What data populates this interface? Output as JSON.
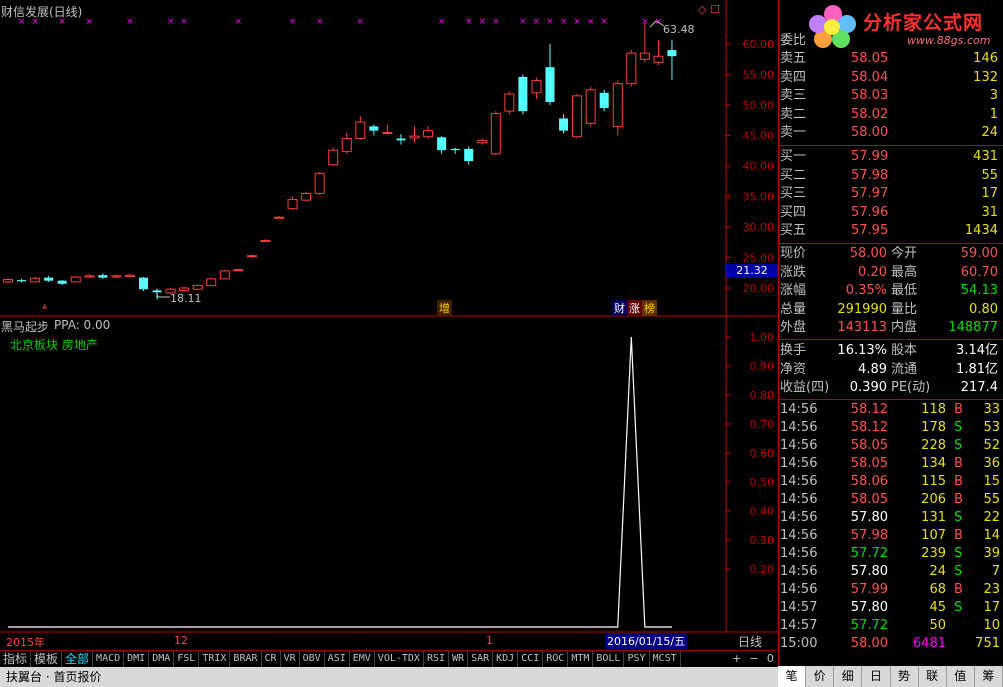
{
  "chart_title": "财信发展(日线)",
  "top_markers": "◇ ☐",
  "price_axis": [
    "60.00",
    "55.00",
    "50.00",
    "45.00",
    "40.00",
    "35.00",
    "30.00",
    "25.00",
    "20.00"
  ],
  "current_price_tag": "21.32",
  "high_label": "63.48",
  "low_label": "18.11",
  "event_labels": {
    "zeng": "增",
    "cai": "财",
    "zhang": "涨",
    "bang": "榜"
  },
  "indicator_name": "黑马起步",
  "indicator_value": "PPA: 0.00",
  "sector_text": "北京板块 房地产",
  "indicator_axis": [
    "1.00",
    "0.90",
    "0.80",
    "0.70",
    "0.60",
    "0.50",
    "0.40",
    "0.30",
    "0.20"
  ],
  "time_axis": {
    "y2015": "2015年",
    "m12": "12",
    "m1": "1",
    "cursor_date": "2016/01/15/五",
    "period": "日线"
  },
  "bottom_tabs": [
    "指标",
    "模板",
    "全部",
    "MACD",
    "DMI",
    "DMA",
    "FSL",
    "TRIX",
    "BRAR",
    "CR",
    "VR",
    "OBV",
    "ASI",
    "EMV",
    "VOL-TDX",
    "RSI",
    "WR",
    "SAR",
    "KDJ",
    "CCI",
    "ROC",
    "MTM",
    "BOLL",
    "PSY",
    "MCST"
  ],
  "right_controls": [
    "+",
    "−",
    "0"
  ],
  "statusbar": {
    "left": "扶翼台 · 首页报价"
  },
  "logo": {
    "title": "分析家公式网",
    "url": "www.88gs.com"
  },
  "orderbook": {
    "header_label": "委比",
    "asks": [
      {
        "label": "卖五",
        "price": "58.05",
        "vol": "146"
      },
      {
        "label": "卖四",
        "price": "58.04",
        "vol": "132"
      },
      {
        "label": "卖三",
        "price": "58.03",
        "vol": "3"
      },
      {
        "label": "卖二",
        "price": "58.02",
        "vol": "1"
      },
      {
        "label": "卖一",
        "price": "58.00",
        "vol": "24"
      }
    ],
    "bids": [
      {
        "label": "买一",
        "price": "57.99",
        "vol": "431"
      },
      {
        "label": "买二",
        "price": "57.98",
        "vol": "55"
      },
      {
        "label": "买三",
        "price": "57.97",
        "vol": "17"
      },
      {
        "label": "买四",
        "price": "57.96",
        "vol": "31"
      },
      {
        "label": "买五",
        "price": "57.95",
        "vol": "1434"
      }
    ]
  },
  "quote": [
    {
      "l1": "现价",
      "v1": "58.00",
      "c1": "red",
      "l2": "今开",
      "v2": "59.00",
      "c2": "red"
    },
    {
      "l1": "涨跌",
      "v1": "0.20",
      "c1": "red",
      "l2": "最高",
      "v2": "60.70",
      "c2": "red"
    },
    {
      "l1": "涨幅",
      "v1": "0.35%",
      "c1": "red",
      "l2": "最低",
      "v2": "54.13",
      "c2": "green"
    },
    {
      "l1": "总量",
      "v1": "291990",
      "c1": "yellow",
      "l2": "量比",
      "v2": "0.80",
      "c2": "yellow"
    },
    {
      "l1": "外盘",
      "v1": "143113",
      "c1": "red",
      "l2": "内盘",
      "v2": "148877",
      "c2": "green"
    }
  ],
  "fundamentals": [
    {
      "l1": "换手",
      "v1": "16.13%",
      "l2": "股本",
      "v2": "3.14亿"
    },
    {
      "l1": "净资",
      "v1": "4.89",
      "l2": "流通",
      "v2": "1.81亿"
    },
    {
      "l1": "收益(四)",
      "v1": "0.390",
      "l2": "PE(动)",
      "v2": "217.4"
    }
  ],
  "ticks": [
    {
      "t": "14:56",
      "p": "58.12",
      "pc": "red",
      "v": "118",
      "s": "B",
      "n": "33"
    },
    {
      "t": "14:56",
      "p": "58.12",
      "pc": "red",
      "v": "178",
      "s": "S",
      "n": "53"
    },
    {
      "t": "14:56",
      "p": "58.05",
      "pc": "red",
      "v": "228",
      "s": "S",
      "n": "52"
    },
    {
      "t": "14:56",
      "p": "58.05",
      "pc": "red",
      "v": "134",
      "s": "B",
      "n": "36"
    },
    {
      "t": "14:56",
      "p": "58.06",
      "pc": "red",
      "v": "115",
      "s": "B",
      "n": "15"
    },
    {
      "t": "14:56",
      "p": "58.05",
      "pc": "red",
      "v": "206",
      "s": "B",
      "n": "55"
    },
    {
      "t": "14:56",
      "p": "57.80",
      "pc": "white",
      "v": "131",
      "s": "S",
      "n": "22"
    },
    {
      "t": "14:56",
      "p": "57.98",
      "pc": "red",
      "v": "107",
      "s": "B",
      "n": "14"
    },
    {
      "t": "14:56",
      "p": "57.72",
      "pc": "green",
      "v": "239",
      "s": "S",
      "n": "39"
    },
    {
      "t": "14:56",
      "p": "57.80",
      "pc": "white",
      "v": "24",
      "s": "S",
      "n": "7"
    },
    {
      "t": "14:56",
      "p": "57.99",
      "pc": "red",
      "v": "68",
      "s": "B",
      "n": "23"
    },
    {
      "t": "14:57",
      "p": "57.80",
      "pc": "white",
      "v": "45",
      "s": "S",
      "n": "17"
    },
    {
      "t": "14:57",
      "p": "57.72",
      "pc": "green",
      "v": "50",
      "s": "",
      "n": "10"
    },
    {
      "t": "15:00",
      "p": "58.00",
      "pc": "red",
      "v": "6481",
      "s": "",
      "n": "751"
    }
  ],
  "right_tabs": [
    "笔",
    "价",
    "细",
    "日",
    "势",
    "联",
    "值",
    "筹"
  ],
  "candles": [
    {
      "o": 21.0,
      "c": 21.4,
      "h": 21.6,
      "l": 20.8
    },
    {
      "o": 21.3,
      "c": 21.1,
      "h": 21.5,
      "l": 20.9
    },
    {
      "o": 21.0,
      "c": 21.6,
      "h": 21.8,
      "l": 20.9
    },
    {
      "o": 21.7,
      "c": 21.2,
      "h": 22.0,
      "l": 21.0
    },
    {
      "o": 21.2,
      "c": 20.7,
      "h": 21.3,
      "l": 20.5
    },
    {
      "o": 21.0,
      "c": 21.8,
      "h": 22.0,
      "l": 20.9
    },
    {
      "o": 21.8,
      "c": 22.0,
      "h": 22.3,
      "l": 21.6
    },
    {
      "o": 22.1,
      "c": 21.7,
      "h": 22.4,
      "l": 21.5
    },
    {
      "o": 21.8,
      "c": 22.0,
      "h": 22.2,
      "l": 21.6
    },
    {
      "o": 21.9,
      "c": 22.1,
      "h": 22.3,
      "l": 21.7
    },
    {
      "o": 21.7,
      "c": 19.8,
      "h": 21.8,
      "l": 19.5
    },
    {
      "o": 19.6,
      "c": 19.3,
      "h": 19.9,
      "l": 18.11
    },
    {
      "o": 19.2,
      "c": 19.8,
      "h": 20.0,
      "l": 19.0
    },
    {
      "o": 19.6,
      "c": 20.0,
      "h": 20.2,
      "l": 19.4
    },
    {
      "o": 19.8,
      "c": 20.4,
      "h": 20.6,
      "l": 19.7
    },
    {
      "o": 20.4,
      "c": 21.5,
      "h": 21.7,
      "l": 20.3
    },
    {
      "o": 21.5,
      "c": 22.8,
      "h": 23.0,
      "l": 21.4
    },
    {
      "o": 23.0,
      "c": 23.0,
      "h": 23.2,
      "l": 22.8
    },
    {
      "o": 25.3,
      "c": 25.3,
      "h": 25.5,
      "l": 25.1
    },
    {
      "o": 27.8,
      "c": 27.8,
      "h": 28.0,
      "l": 27.6
    },
    {
      "o": 31.6,
      "c": 31.6,
      "h": 31.8,
      "l": 31.4
    },
    {
      "o": 33.0,
      "c": 34.5,
      "h": 35.0,
      "l": 32.8
    },
    {
      "o": 34.4,
      "c": 35.5,
      "h": 35.8,
      "l": 34.2
    },
    {
      "o": 35.5,
      "c": 38.8,
      "h": 39.0,
      "l": 35.3
    },
    {
      "o": 40.2,
      "c": 42.6,
      "h": 43.0,
      "l": 40.0
    },
    {
      "o": 42.4,
      "c": 44.5,
      "h": 45.5,
      "l": 42.0
    },
    {
      "o": 44.5,
      "c": 47.2,
      "h": 48.2,
      "l": 44.3
    },
    {
      "o": 46.5,
      "c": 45.8,
      "h": 46.8,
      "l": 45.0
    },
    {
      "o": 45.5,
      "c": 45.5,
      "h": 46.8,
      "l": 45.3
    },
    {
      "o": 44.5,
      "c": 44.2,
      "h": 45.2,
      "l": 43.5
    },
    {
      "o": 44.6,
      "c": 44.9,
      "h": 46.5,
      "l": 43.8
    },
    {
      "o": 44.8,
      "c": 45.8,
      "h": 46.5,
      "l": 44.5
    },
    {
      "o": 44.7,
      "c": 42.6,
      "h": 44.9,
      "l": 42.0
    },
    {
      "o": 42.8,
      "c": 42.6,
      "h": 43.0,
      "l": 42.0
    },
    {
      "o": 42.8,
      "c": 40.8,
      "h": 43.2,
      "l": 40.2
    },
    {
      "o": 43.8,
      "c": 44.2,
      "h": 44.5,
      "l": 43.5
    },
    {
      "o": 42.0,
      "c": 48.6,
      "h": 49.0,
      "l": 41.8
    },
    {
      "o": 49.0,
      "c": 51.8,
      "h": 52.2,
      "l": 48.5
    },
    {
      "o": 54.6,
      "c": 49.0,
      "h": 55.0,
      "l": 48.5
    },
    {
      "o": 52.0,
      "c": 54.0,
      "h": 54.5,
      "l": 51.0
    },
    {
      "o": 56.2,
      "c": 50.5,
      "h": 60.0,
      "l": 50.0
    },
    {
      "o": 47.8,
      "c": 45.8,
      "h": 48.5,
      "l": 45.3
    },
    {
      "o": 44.8,
      "c": 51.5,
      "h": 51.8,
      "l": 44.5
    },
    {
      "o": 47.0,
      "c": 52.5,
      "h": 53.0,
      "l": 46.5
    },
    {
      "o": 52.0,
      "c": 49.5,
      "h": 52.5,
      "l": 49.0
    },
    {
      "o": 46.5,
      "c": 53.5,
      "h": 54.0,
      "l": 45.0
    },
    {
      "o": 53.5,
      "c": 58.5,
      "h": 59.0,
      "l": 53.0
    },
    {
      "o": 57.5,
      "c": 58.5,
      "h": 63.48,
      "l": 57.0
    },
    {
      "o": 57.0,
      "c": 58.0,
      "h": 60.7,
      "l": 56.5
    },
    {
      "o": 59.0,
      "c": 58.0,
      "h": 60.7,
      "l": 54.13
    }
  ],
  "markers": [
    1,
    2,
    4,
    6,
    9,
    12,
    13,
    17,
    21,
    23,
    26,
    32,
    34,
    35,
    36,
    38,
    39,
    40,
    41,
    42,
    43,
    44,
    47,
    48
  ]
}
